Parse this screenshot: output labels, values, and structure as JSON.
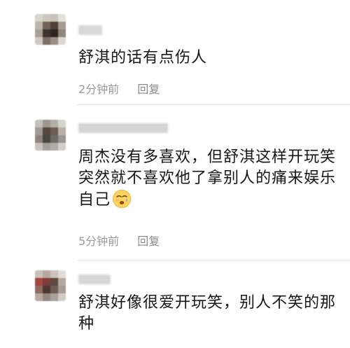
{
  "comments": [
    {
      "text": "舒淇的话有点伤人",
      "time": "2分钟前",
      "reply_label": "回复"
    },
    {
      "text": "周杰没有多喜欢，但舒淇这样开玩笑突然就不喜欢他了拿别人的痛来娱乐自己",
      "time": "5分钟前",
      "reply_label": "回复",
      "emoji_icon": "crying-face-icon"
    },
    {
      "text": "舒淇好像很爱开玩笑，别人不笑的那种"
    }
  ],
  "colors": {
    "text": "#161616",
    "meta": "#999999",
    "divider": "#e6e6e6",
    "background": "#ffffff"
  }
}
